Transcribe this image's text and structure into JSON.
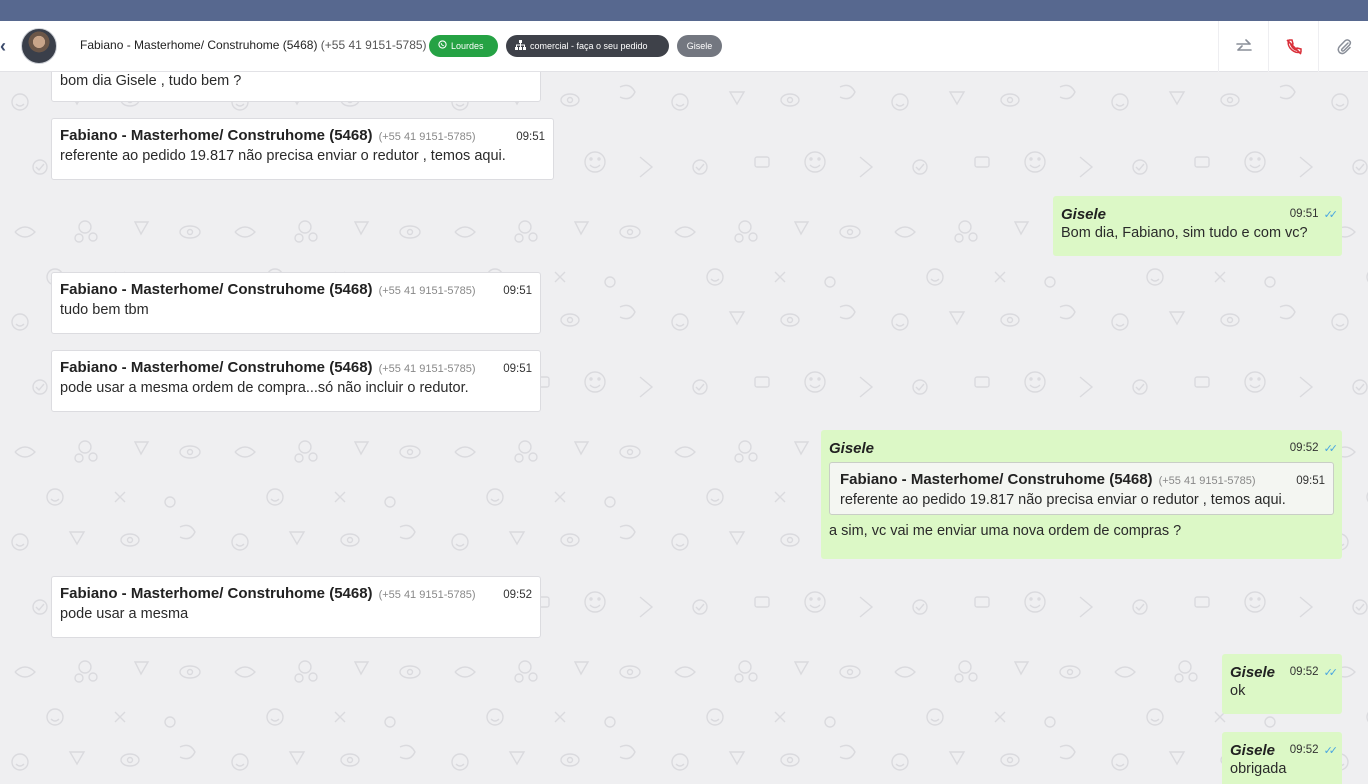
{
  "header": {
    "contact_name": "Fabiano - Masterhome/ Construhome (5468)",
    "contact_phone": "(+55 41 9151-5785)",
    "tags": {
      "connection": "Lourdes",
      "queue": "comercial - faça o seu pedido",
      "user": "Gisele"
    },
    "icons": {
      "back": "chevron-left-icon",
      "whatsapp": "whatsapp-icon",
      "queue": "sitemap-icon",
      "transfer": "transfer-icon",
      "end_call": "phone-slash-icon",
      "attach": "paperclip-icon"
    }
  },
  "messages": [
    {
      "direction": "in",
      "body": "bom dia Gisele , tudo bem ?"
    },
    {
      "direction": "in",
      "sender": "Fabiano - Masterhome/ Construhome (5468)",
      "phone": "(+55 41 9151-5785)",
      "time": "09:51",
      "body": "referente ao pedido 19.817 não precisa enviar o redutor , temos aqui."
    },
    {
      "direction": "out",
      "sender": "Gisele",
      "time": "09:51",
      "body": "Bom dia, Fabiano, sim tudo e com vc?"
    },
    {
      "direction": "in",
      "sender": "Fabiano - Masterhome/ Construhome (5468)",
      "phone": "(+55 41 9151-5785)",
      "time": "09:51",
      "body": "tudo bem tbm"
    },
    {
      "direction": "in",
      "sender": "Fabiano - Masterhome/ Construhome (5468)",
      "phone": "(+55 41 9151-5785)",
      "time": "09:51",
      "body": "pode usar a mesma ordem de compra...só não incluir o redutor."
    },
    {
      "direction": "out",
      "sender": "Gisele",
      "time": "09:52",
      "quoted": {
        "sender": "Fabiano - Masterhome/ Construhome (5468)",
        "phone": "(+55 41 9151-5785)",
        "time": "09:51",
        "body": "referente ao pedido 19.817 não precisa enviar o redutor , temos aqui."
      },
      "body": "a sim, vc vai me enviar uma nova ordem de compras ?"
    },
    {
      "direction": "in",
      "sender": "Fabiano - Masterhome/ Construhome (5468)",
      "phone": "(+55 41 9151-5785)",
      "time": "09:52",
      "body": "pode usar a mesma"
    },
    {
      "direction": "out",
      "sender": "Gisele",
      "time": "09:52",
      "body": "ok"
    },
    {
      "direction": "out",
      "sender": "Gisele",
      "time": "09:52",
      "body": "obrigada"
    }
  ],
  "colors": {
    "topbar": "#57688f",
    "outgoing_bubble": "#dcf8c6",
    "tag_whatsapp": "#25a244",
    "tag_queue": "#3e4149",
    "tag_user": "#737780",
    "read_check": "#4aa6e0",
    "end_call": "#d9303a"
  }
}
